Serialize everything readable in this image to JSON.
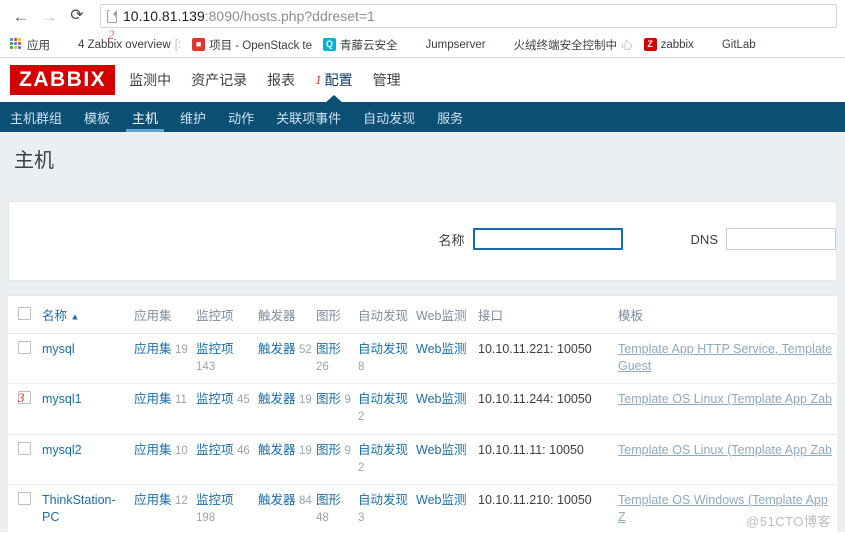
{
  "browser": {
    "back_icon": "←",
    "forward_icon": "→",
    "reload_icon": "⟳",
    "url_host": "10.10.81.139",
    "url_rest": ":8090/hosts.php?ddreset=1",
    "page_icon": "page-icon",
    "bookmarks": [
      {
        "label": "应用",
        "icon": "apps-grid-icon",
        "faded": ""
      },
      {
        "label": "4 Zabbix overview",
        "icon": "zabbix-overview-icon",
        "faded": "[:"
      },
      {
        "label": "项目 - OpenStack te",
        "icon": "openstack-icon",
        "faded": ""
      },
      {
        "label": "青藤云安全",
        "icon": "qingteng-icon",
        "faded": ""
      },
      {
        "label": "Jumpserver",
        "icon": "jumpserver-icon",
        "faded": ""
      },
      {
        "label": "火绒终端安全控制中",
        "icon": "huorong-icon",
        "faded": "心"
      },
      {
        "label": "zabbix",
        "icon": "zabbix-icon",
        "faded": ""
      },
      {
        "label": "GitLab",
        "icon": "gitlab-icon",
        "faded": ""
      }
    ]
  },
  "zabbix": {
    "logo": "ZABBIX",
    "menu": [
      {
        "label": "监测中",
        "active": false
      },
      {
        "label": "资产记录",
        "active": false
      },
      {
        "label": "报表",
        "active": false
      },
      {
        "label": "配置",
        "active": true
      },
      {
        "label": "管理",
        "active": false
      }
    ],
    "annotations": {
      "one": "1",
      "two": "2",
      "three": "3"
    },
    "subnav": [
      {
        "label": "主机群组",
        "active": false
      },
      {
        "label": "模板",
        "active": false
      },
      {
        "label": "主机",
        "active": true
      },
      {
        "label": "维护",
        "active": false
      },
      {
        "label": "动作",
        "active": false
      },
      {
        "label": "关联项事件",
        "active": false
      },
      {
        "label": "自动发现",
        "active": false
      },
      {
        "label": "服务",
        "active": false
      }
    ],
    "page_title": "主机"
  },
  "filter": {
    "name_label": "名称",
    "name_value": "",
    "name_placeholder": "",
    "dns_label": "DNS",
    "dns_value": "",
    "dns_placeholder": ""
  },
  "table": {
    "headers": {
      "name": "名称",
      "sort_arrow": "▲",
      "applications": "应用集",
      "items": "监控项",
      "triggers": "触发器",
      "graphs": "图形",
      "discovery": "自动发现",
      "web": "Web监测",
      "interface": "接口",
      "templates": "模板"
    },
    "labels": {
      "applications": "应用集",
      "items": "监控项",
      "triggers": "触发器",
      "graphs": "图形",
      "discovery": "自动发现",
      "web": "Web监测"
    },
    "rows": [
      {
        "name": "mysql",
        "applications": "19",
        "items": "143",
        "triggers": "52",
        "graphs": "26",
        "discovery": "8",
        "interface": "10.10.11.221: 10050",
        "templates": "Template App HTTP Service, Template Guest"
      },
      {
        "name": "mysql1",
        "applications": "11",
        "items": "45",
        "triggers": "19",
        "graphs": "9",
        "discovery": "2",
        "interface": "10.10.11.244: 10050",
        "templates": "Template OS Linux (Template App Zab"
      },
      {
        "name": "mysql2",
        "applications": "10",
        "items": "46",
        "triggers": "19",
        "graphs": "9",
        "discovery": "2",
        "interface": "10.10.11.11: 10050",
        "templates": "Template OS Linux (Template App Zab"
      },
      {
        "name": "ThinkStation-PC",
        "applications": "12",
        "items": "198",
        "triggers": "84",
        "graphs": "48",
        "discovery": "3",
        "interface": "10.10.11.210: 10050",
        "templates": "Template OS Windows (Template App Z"
      }
    ]
  },
  "watermark": "@51CTO博客",
  "colors": {
    "zabbix_red": "#d40000",
    "nav_blue": "#0b4f75",
    "link_blue": "#1a6ea8",
    "annotation_red": "#e03030"
  }
}
